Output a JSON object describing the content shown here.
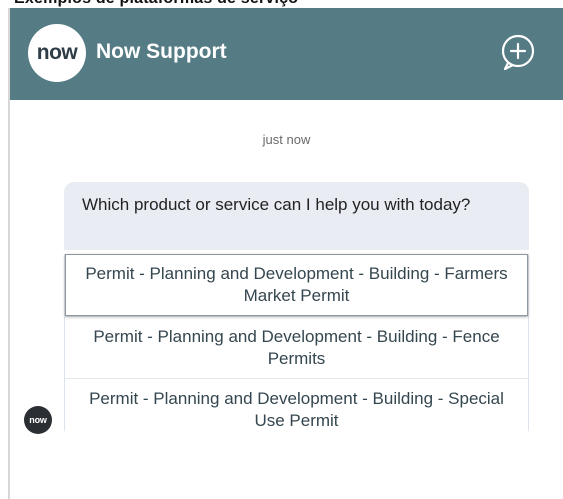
{
  "header": {
    "logo_text": "now",
    "title": "Now Support",
    "new_chat_icon": "add-chat-icon"
  },
  "top_fragment": {
    "text": "Exemplos de plataformas de serviço"
  },
  "chat": {
    "timestamp": "just now",
    "message": "Which product or service can I help you with today?",
    "options": [
      "Permit - Planning and Development - Building - Farmers Market Permit",
      "Permit - Planning and Development - Building - Fence Permits",
      "Permit - Planning and Development - Building - Special Use Permit"
    ],
    "avatar_text": "now"
  },
  "colors": {
    "header_bg": "#557b84",
    "bubble_bg": "#e9edf3",
    "avatar_bg": "#2b2f33",
    "option_text": "#34464f"
  }
}
